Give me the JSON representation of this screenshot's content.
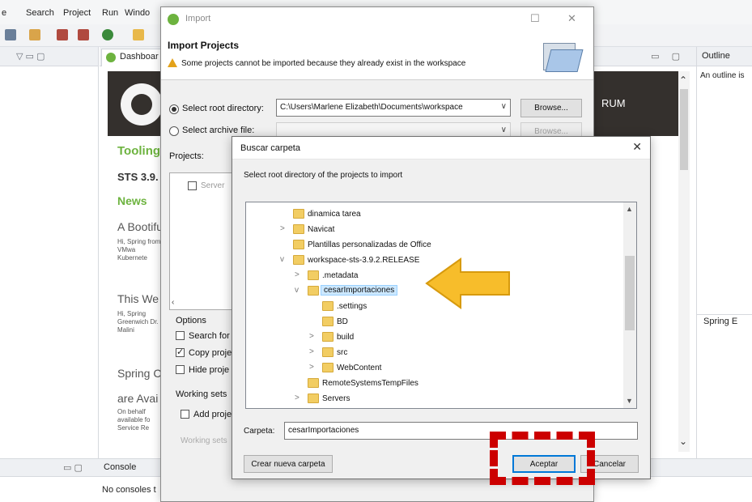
{
  "ide": {
    "menu": [
      "e",
      "Search",
      "Project",
      "Run",
      "Windo"
    ],
    "dashboard_tab": "Dashboar",
    "outline_tab": "Outline",
    "outline_message": "An outline is",
    "spring_explorer_tab": "Spring E",
    "console_tab": "Console",
    "console_message": "No consoles t",
    "banner_right": "RUM",
    "dashboard": {
      "tooling": "Tooling",
      "sts": "STS 3.9.",
      "news": "News",
      "item1": "A Bootifu",
      "item1_text": "Hi, Spring from VMwa Kubernete",
      "item2": "This We",
      "item2_text": "Hi, Spring Greenwich Dr. Malini",
      "item3": "Spring C",
      "item4": "are Avai",
      "item4_text": "On behalf available fo Service Re"
    }
  },
  "import_dialog": {
    "title": "Import",
    "heading": "Import Projects",
    "warning": "Some projects cannot be imported because they already exist in the workspace",
    "root_label": "Select root directory:",
    "root_value": "C:\\Users\\Marlene Elizabeth\\Documents\\workspace",
    "archive_label": "Select archive file:",
    "browse": "Browse...",
    "projects_label": "Projects:",
    "project_item": "Server",
    "options_label": "Options",
    "search_for": "Search for",
    "copy_projects": "Copy proje",
    "hide_projects": "Hide proje",
    "working_sets": "Working sets",
    "add_project": "Add proje",
    "working_set_field": "Working sets"
  },
  "folder_dialog": {
    "title": "Buscar carpeta",
    "description": "Select root directory of the projects to import",
    "tree": [
      {
        "label": "dinamica tarea",
        "expander": ""
      },
      {
        "label": "Navicat",
        "expander": ">"
      },
      {
        "label": "Plantillas personalizadas de Office",
        "expander": ""
      },
      {
        "label": "workspace-sts-3.9.2.RELEASE",
        "expander": "v"
      },
      {
        "label": ".metadata",
        "expander": ">"
      },
      {
        "label": "cesarImportaciones",
        "expander": "v"
      },
      {
        "label": ".settings",
        "expander": ""
      },
      {
        "label": "BD",
        "expander": ""
      },
      {
        "label": "build",
        "expander": ">"
      },
      {
        "label": "src",
        "expander": ">"
      },
      {
        "label": "WebContent",
        "expander": ">"
      },
      {
        "label": "RemoteSystemsTempFiles",
        "expander": ""
      },
      {
        "label": "Servers",
        "expander": ">"
      }
    ],
    "folder_label": "Carpeta:",
    "folder_value": "cesarImportaciones",
    "new_folder": "Crear nueva carpeta",
    "accept": "Aceptar",
    "cancel": "Cancelar"
  },
  "colors": {
    "spring_green": "#6db33f",
    "arrow_fill": "#f7bd2b",
    "annotation_red": "#cc0000",
    "selection": "#cce8ff"
  }
}
